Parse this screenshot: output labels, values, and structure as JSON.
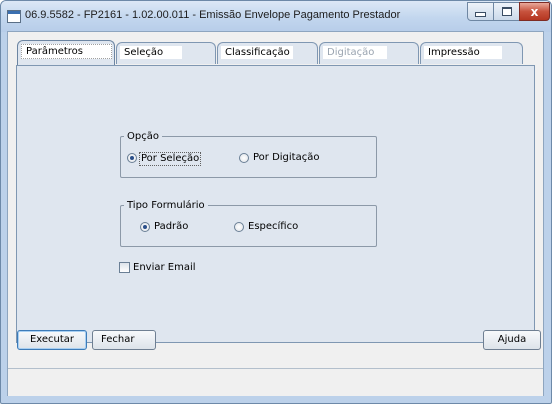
{
  "window": {
    "title": "06.9.5582 - FP2161 - 1.02.00.011 - Emissão Envelope Pagamento Prestador",
    "close_glyph": "x"
  },
  "tabs": [
    {
      "label": "Parâmetros",
      "state": "active"
    },
    {
      "label": "Seleção",
      "state": "normal"
    },
    {
      "label": "Classificação",
      "state": "normal"
    },
    {
      "label": "Digitação",
      "state": "disabled"
    },
    {
      "label": "Impressão",
      "state": "normal"
    }
  ],
  "opcao": {
    "legend": "Opção",
    "options": [
      {
        "label": "Por Seleção",
        "checked": true
      },
      {
        "label": "Por Digitação",
        "checked": false
      }
    ]
  },
  "tipo_formulario": {
    "legend": "Tipo Formulário",
    "options": [
      {
        "label": "Padrão",
        "checked": true
      },
      {
        "label": "Específico",
        "checked": false
      }
    ]
  },
  "enviar_email": {
    "label": "Enviar Email",
    "checked": false
  },
  "buttons": {
    "executar": "Executar",
    "fechar": "Fechar",
    "ajuda": "Ajuda"
  },
  "colors": {
    "frame": "#bcd1ea",
    "panel": "#dfe6ef",
    "default_button_border": "#3d7bb8"
  }
}
